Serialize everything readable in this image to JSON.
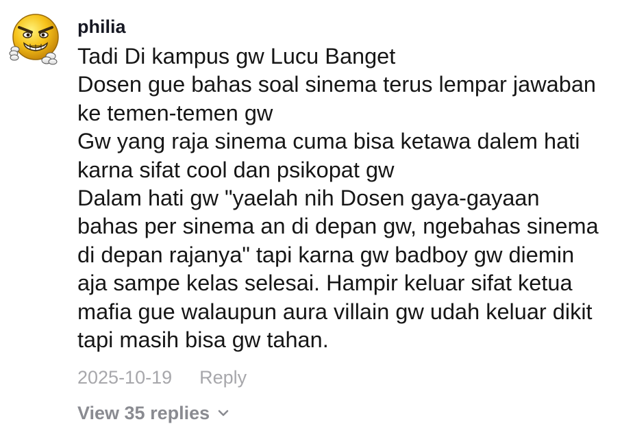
{
  "comment": {
    "username": "philia",
    "avatar_icon": "angry-grinning-emoji-icon",
    "lines": [
      "Tadi Di kampus gw Lucu Banget",
      "Dosen gue bahas soal sinema terus lempar jawaban",
      "ke temen-temen gw",
      "Gw yang raja sinema cuma bisa ketawa dalem hati",
      "karna sifat cool dan psikopat gw",
      "Dalam hati gw \"yaelah nih Dosen gaya-gayaan",
      "bahas per sinema an di depan gw, ngebahas sinema",
      "di depan rajanya\" tapi karna gw badboy gw diemin",
      "aja sampe kelas selesai. Hampir keluar sifat ketua",
      "mafia gue walaupun aura villain gw udah keluar dikit",
      "tapi masih bisa gw tahan."
    ],
    "date": "2025-10-19",
    "reply_label": "Reply",
    "view_replies_label": "View 35 replies",
    "view_replies_icon": "chevron-down-icon"
  },
  "colors": {
    "text": "#161616",
    "meta": "#a7a7ab",
    "view_replies": "#8a8b91",
    "emoji_face": "#f6c21a"
  }
}
